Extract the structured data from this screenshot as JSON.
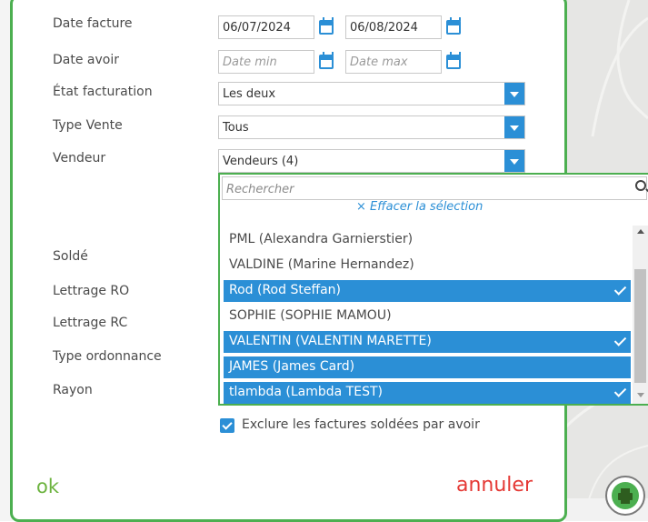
{
  "form": {
    "date_facture_label": "Date facture",
    "date_facture_from": "06/07/2024",
    "date_facture_to": "06/08/2024",
    "date_avoir_label": "Date avoir",
    "date_avoir_min_placeholder": "Date min",
    "date_avoir_max_placeholder": "Date max",
    "etat_facturation_label": "État facturation",
    "etat_facturation_value": "Les deux",
    "type_vente_label": "Type Vente",
    "type_vente_value": "Tous",
    "vendeur_label": "Vendeur",
    "vendeur_value": "Vendeurs (4)",
    "solde_label": "Soldé",
    "lettrage_ro_label": "Lettrage RO",
    "lettrage_rc_label": "Lettrage RC",
    "type_ordonnance_label": "Type ordonnance",
    "rayon_label": "Rayon",
    "exclude_label": "Exclure les factures soldées par avoir",
    "exclude_checked": true
  },
  "dropdown": {
    "search_placeholder": "Rechercher",
    "clear_label": "× Effacer la sélection",
    "items": [
      {
        "label": "PML (Alexandra Garnierstier)",
        "selected": false,
        "checked": false
      },
      {
        "label": "VALDINE (Marine Hernandez)",
        "selected": false,
        "checked": false
      },
      {
        "label": "Rod (Rod Steffan)",
        "selected": true,
        "checked": true
      },
      {
        "label": "SOPHIE (SOPHIE MAMOU)",
        "selected": false,
        "checked": false
      },
      {
        "label": "VALENTIN (VALENTIN MARETTE)",
        "selected": true,
        "checked": true
      },
      {
        "label": "JAMES (James Card)",
        "selected": true,
        "checked": false
      },
      {
        "label": "tlambda (Lambda TEST)",
        "selected": true,
        "checked": true
      }
    ]
  },
  "actions": {
    "ok_label": "ok",
    "cancel_label": "annuler"
  },
  "colors": {
    "accent_green": "#4caf50",
    "select_blue": "#2b8fd6",
    "ok_green": "#6cb33f",
    "cancel_red": "#e53935"
  },
  "icons": {
    "calendar": "calendar-icon",
    "dropdown_arrow": "chevron-down-icon",
    "search": "search-icon",
    "check": "check-icon",
    "print": "print-icon"
  }
}
